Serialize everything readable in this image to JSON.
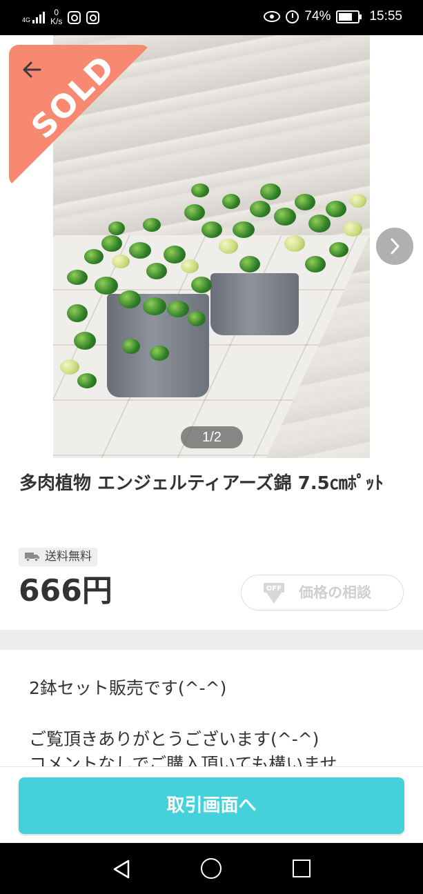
{
  "status_bar": {
    "network": "4G",
    "speed_value": "0",
    "speed_unit": "K/s",
    "battery": "74%",
    "time": "15:55"
  },
  "gallery": {
    "sold_label": "SOLD",
    "page_indicator": "1/2",
    "current_index": 1,
    "total_images": 2
  },
  "item": {
    "title": "多肉植物 エンジェルティアーズ錦 7.5㎝ﾎﾟｯﾄ",
    "shipping_badge": "送料無料",
    "price": "666円",
    "negotiate_label": "価格の相談"
  },
  "description": {
    "lines": [
      "2鉢セット販売です(^-^)",
      "ご覧頂きありがとうございます(^-^)",
      "コメントなしでご購入頂いても構いませ"
    ]
  },
  "footer": {
    "cta_label": "取引画面へ"
  },
  "colors": {
    "sold_badge": "#f6896f",
    "cta": "#45d1db",
    "text": "#333333"
  }
}
